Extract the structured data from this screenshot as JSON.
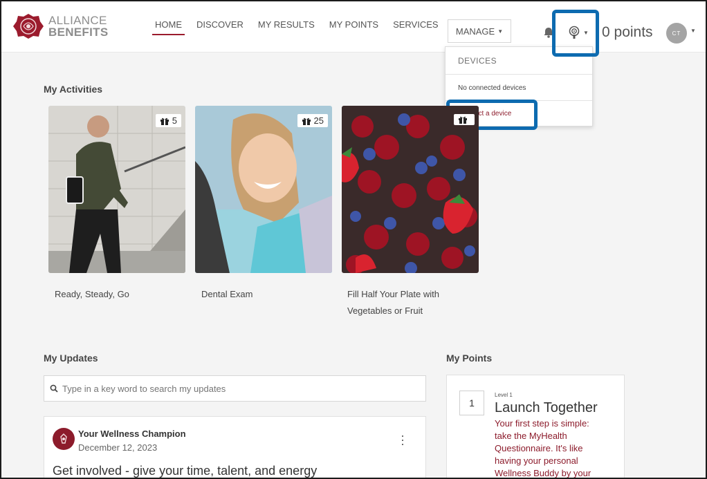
{
  "brand": {
    "line1": "ALLIANCE",
    "line2": "BENEFITS",
    "accent": "#9b1b2d",
    "highlight": "#0d6bb0"
  },
  "nav": {
    "items": [
      {
        "label": "HOME",
        "active": true
      },
      {
        "label": "DISCOVER",
        "active": false
      },
      {
        "label": "MY RESULTS",
        "active": false
      },
      {
        "label": "MY POINTS",
        "active": false
      },
      {
        "label": "SERVICES",
        "active": false
      }
    ],
    "manage_label": "MANAGE",
    "points_label": "0 points",
    "avatar_initials": "CT"
  },
  "devices_menu": {
    "header": "DEVICES",
    "empty": "No connected devices",
    "connect": "Connect a device"
  },
  "activities": {
    "title": "My Activities",
    "items": [
      {
        "title": "Ready, Steady, Go",
        "points": "5"
      },
      {
        "title": "Dental Exam",
        "points": "25"
      },
      {
        "title": "Fill Half Your Plate with Vegetables or Fruit",
        "points": ""
      }
    ]
  },
  "updates": {
    "title": "My Updates",
    "search_placeholder": "Type in a key word to search my updates",
    "post": {
      "author": "Your Wellness Champion",
      "date": "December 12, 2023",
      "headline": "Get involved - give your time, talent, and energy"
    }
  },
  "points_panel": {
    "title": "My Points",
    "level_number": "1",
    "level_label": "Level 1",
    "level_title": "Launch Together",
    "level_desc": "Your first step is simple: take the MyHealth Questionnaire. It's like having your personal Wellness Buddy by your"
  }
}
